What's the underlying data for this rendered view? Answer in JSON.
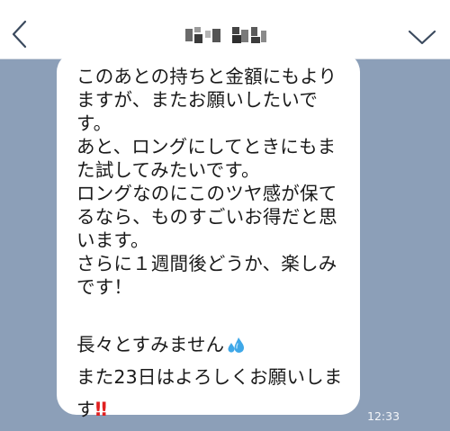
{
  "header": {
    "contact_name": "▪▪▪ ▪▪▪",
    "back_icon": "chevron-left-icon",
    "menu_icon": "chevron-down-icon"
  },
  "message": {
    "lines": [
      "このあとの持ちと金額にもより",
      "ますが、またお願いしたいで",
      "す。",
      "あと、ロングにしてときにもま",
      "た試してみたいです。",
      "ロングなのにこのツヤ感が保て",
      "るなら、ものすごいお得だと思",
      "います。",
      "さらに１週間後どうか、楽しみ",
      "です！"
    ],
    "line_apology": "長々とすみません",
    "line_closing_1": "また23日はよろしくお願いしま",
    "line_closing_2": "す",
    "emoji_sweat": "sweat-droplets-icon",
    "emoji_bang": "‼",
    "time": "12:33"
  },
  "colors": {
    "chat_background": "#8c9fb8",
    "header_background": "#ffffff",
    "bubble": "#ffffff",
    "accent_icon": "#3b4a5e",
    "exclamation": "#e02020"
  }
}
